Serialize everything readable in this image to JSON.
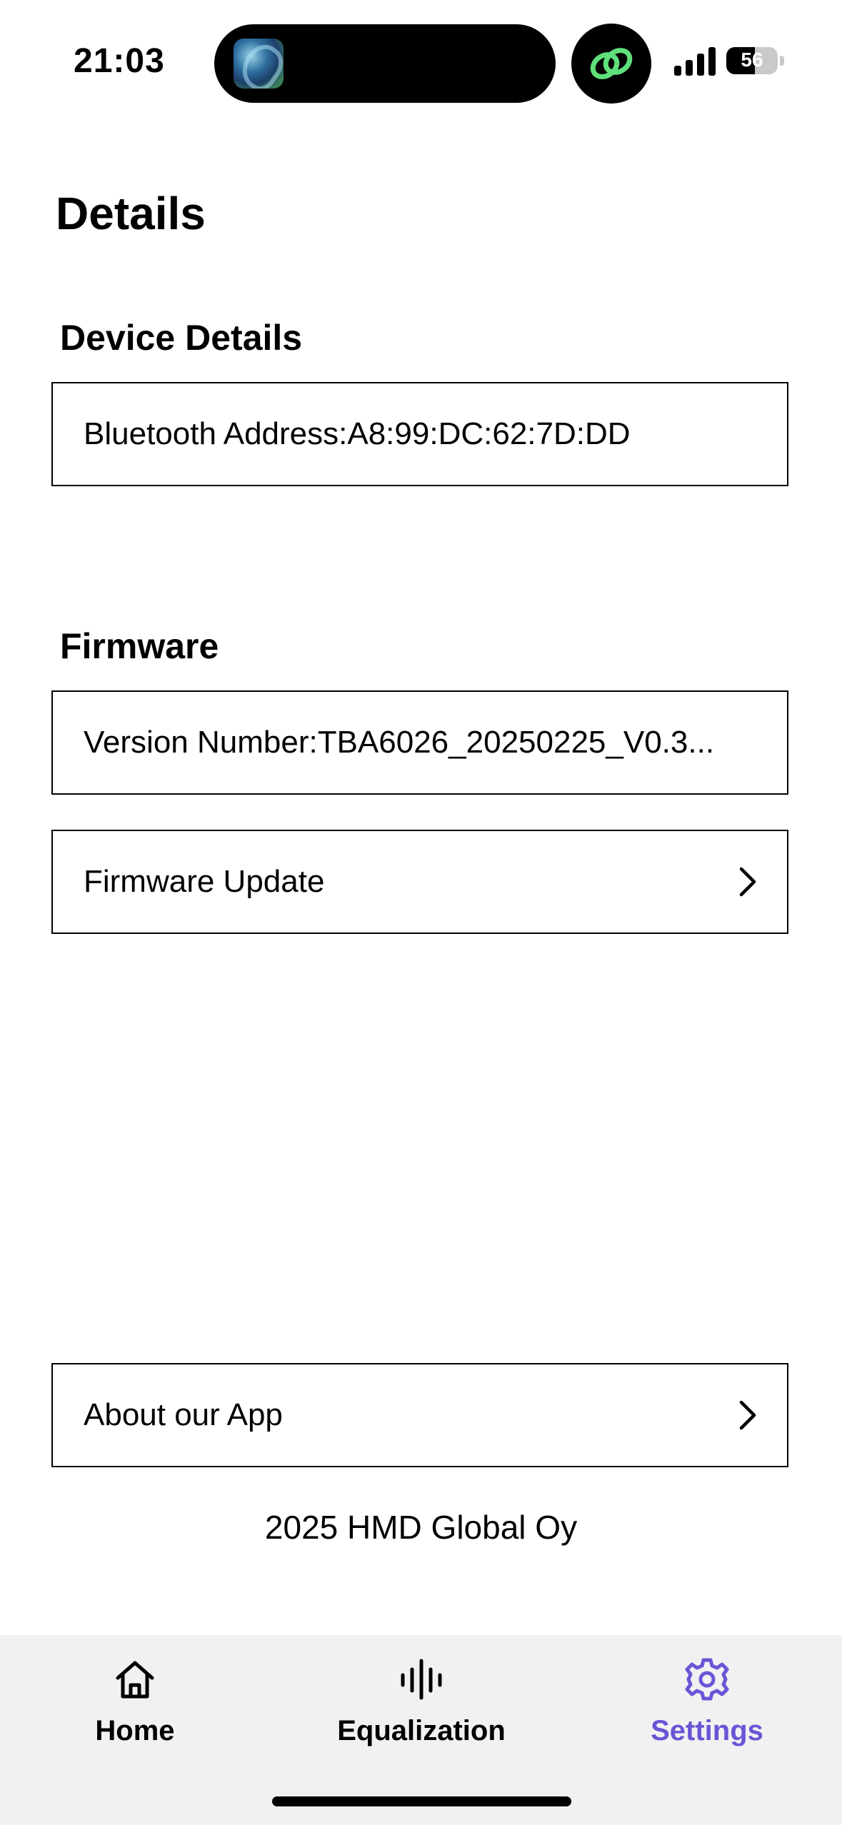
{
  "status_bar": {
    "time": "21:03",
    "battery": "56",
    "battery_level": 0.56,
    "icons": [
      "music-artwork-icon",
      "link-icon",
      "cellular-signal-icon",
      "battery-icon"
    ]
  },
  "page": {
    "title": "Details"
  },
  "sections": {
    "device": {
      "title": "Device Details",
      "bluetooth_address": "Bluetooth Address:A8:99:DC:62:7D:DD"
    },
    "firmware": {
      "title": "Firmware",
      "version": "Version Number:TBA6026_20250225_V0.3...",
      "update_label": "Firmware Update"
    }
  },
  "about": {
    "label": "About our App"
  },
  "footer": {
    "copyright": "2025 HMD Global Oy"
  },
  "tabs": [
    {
      "label": "Home",
      "icon": "home-icon",
      "active": false
    },
    {
      "label": "Equalization",
      "icon": "equalizer-icon",
      "active": false
    },
    {
      "label": "Settings",
      "icon": "gear-icon",
      "active": true
    }
  ],
  "colors": {
    "accent": "#6a55d6",
    "link_green": "#5fe07a",
    "tab_bar_bg": "#f1f1f1"
  }
}
